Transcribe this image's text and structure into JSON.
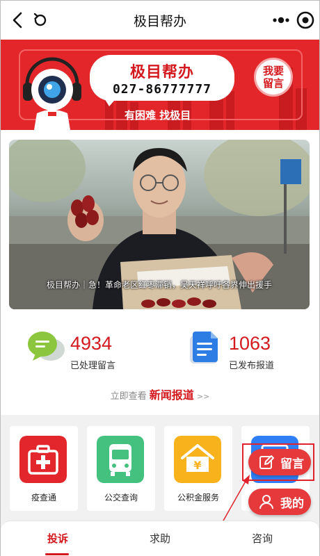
{
  "nav": {
    "title": "极目帮办"
  },
  "banner": {
    "title": "极目帮办",
    "phone": "027-86777777",
    "slogan": "有困难 找极目",
    "leave_msg_line1": "我要",
    "leave_msg_line2": "留言"
  },
  "feature": {
    "caption": "极目帮办｜急！革命老区红枣滞销，吴天祥呼吁各界伸出援手"
  },
  "stats": [
    {
      "value": "4934",
      "label": "已处理留言",
      "icon": "message-bubble-icon"
    },
    {
      "value": "1063",
      "label": "已发布报道",
      "icon": "document-icon"
    }
  ],
  "news": {
    "prefix": "立即查看",
    "highlight": "新闻报道",
    "suffix": ">>"
  },
  "services": [
    {
      "label": "疫查通",
      "icon": "medical-kit-icon",
      "color": "#e2262b"
    },
    {
      "label": "公交查询",
      "icon": "bus-icon",
      "color": "#44c17f"
    },
    {
      "label": "公积金服务",
      "icon": "housing-fund-icon",
      "color": "#f7b21c"
    },
    {
      "label": "",
      "icon": "blue-service-icon",
      "color": "#2f7ef5"
    }
  ],
  "fabs": {
    "leave_message": "留言",
    "mine": "我的"
  },
  "tabs": [
    {
      "label": "投诉",
      "active": true
    },
    {
      "label": "求助",
      "active": false
    },
    {
      "label": "咨询",
      "active": false
    }
  ],
  "colors": {
    "brand_red": "#e3262a",
    "text_red": "#d4191e"
  }
}
